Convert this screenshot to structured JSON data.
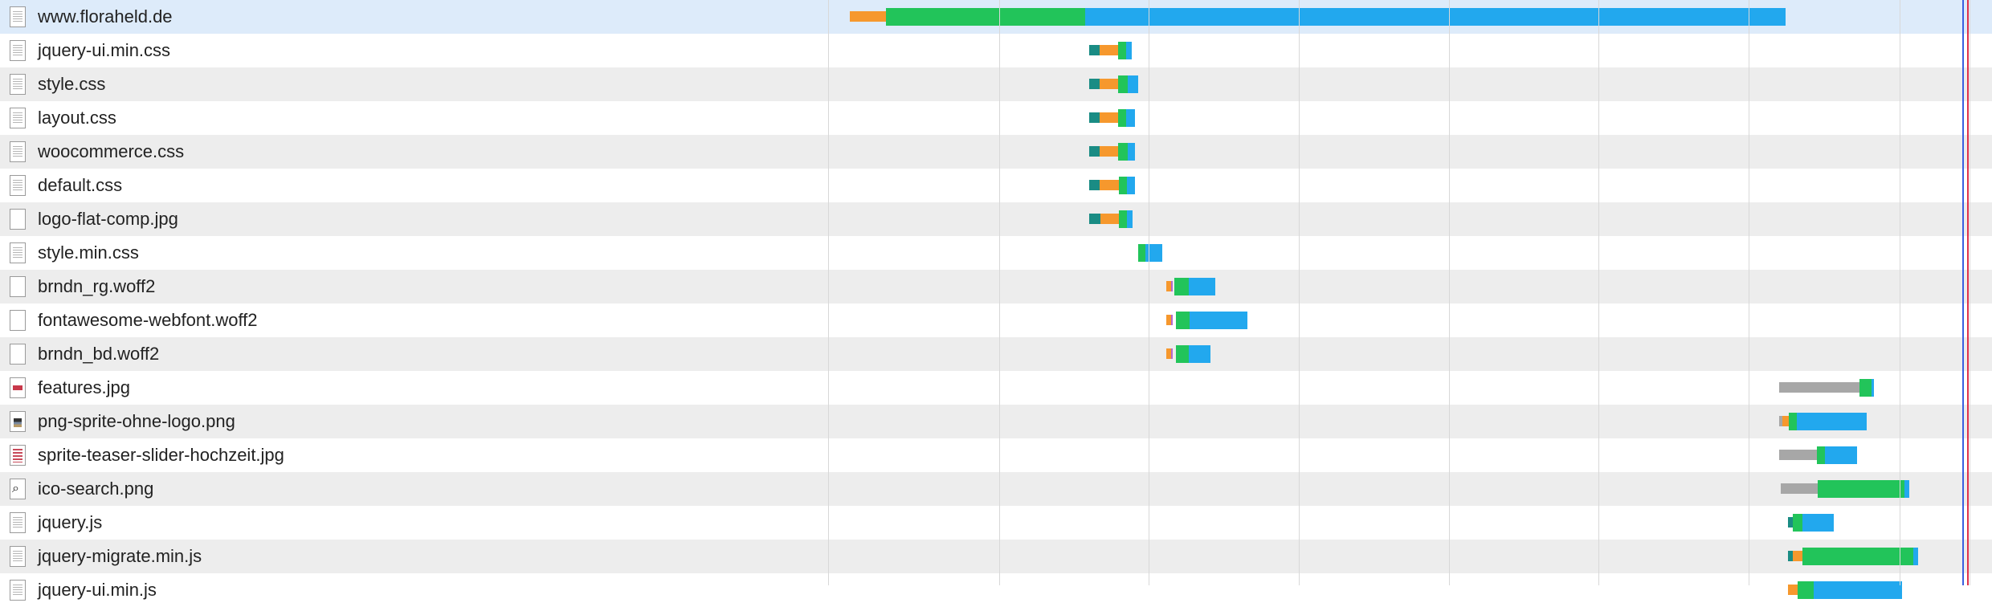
{
  "colors": {
    "dns": "#1a8c84",
    "connect": "#f6982d",
    "ssl": "#b06ad0",
    "wait": "#22c45a",
    "receive": "#22a8ee",
    "blocked": "#a7a7a7",
    "dom_content_loaded": "#3b5fe0",
    "load": "#e0304a"
  },
  "requests": [
    {
      "name": "www.floraheld.de",
      "icon": "document-icon"
    },
    {
      "name": "jquery-ui.min.css",
      "icon": "document-icon"
    },
    {
      "name": "style.css",
      "icon": "document-icon"
    },
    {
      "name": "layout.css",
      "icon": "document-icon"
    },
    {
      "name": "woocommerce.css",
      "icon": "document-icon"
    },
    {
      "name": "default.css",
      "icon": "document-icon"
    },
    {
      "name": "logo-flat-comp.jpg",
      "icon": "image-icon"
    },
    {
      "name": "style.min.css",
      "icon": "document-icon"
    },
    {
      "name": "brndn_rg.woff2",
      "icon": "blank-file-icon"
    },
    {
      "name": "fontawesome-webfont.woff2",
      "icon": "blank-file-icon"
    },
    {
      "name": "brndn_bd.woff2",
      "icon": "blank-file-icon"
    },
    {
      "name": "features.jpg",
      "icon": "image-thumbnail-icon"
    },
    {
      "name": "png-sprite-ohne-logo.png",
      "icon": "image-thumbnail-icon"
    },
    {
      "name": "sprite-teaser-slider-hochzeit.jpg",
      "icon": "image-thumbnail-icon"
    },
    {
      "name": "ico-search.png",
      "icon": "search-thumbnail-icon"
    },
    {
      "name": "jquery.js",
      "icon": "document-icon"
    },
    {
      "name": "jquery-migrate.min.js",
      "icon": "document-icon"
    },
    {
      "name": "jquery-ui.min.js",
      "icon": "document-icon"
    }
  ]
}
